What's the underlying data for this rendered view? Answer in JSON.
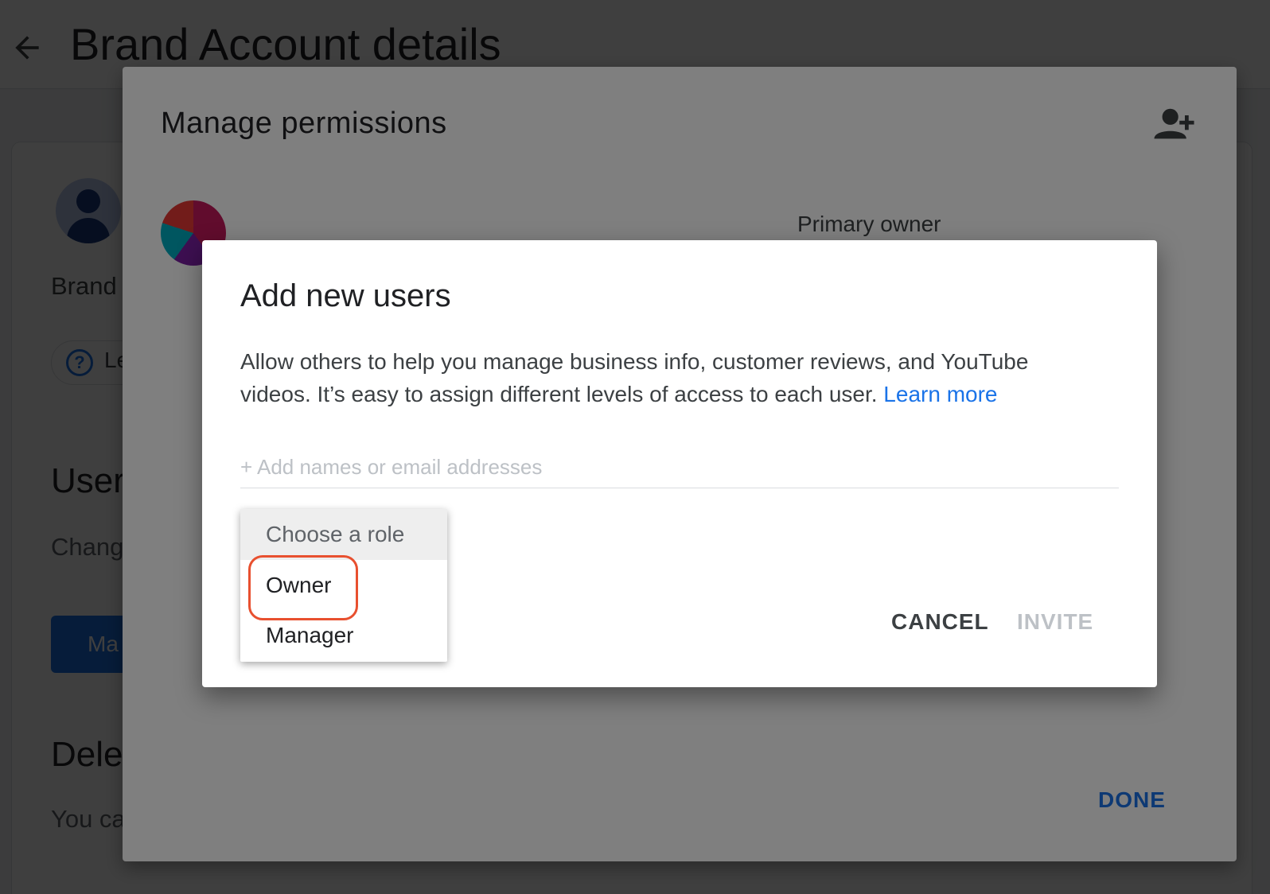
{
  "background": {
    "page_title": "Brand Account details",
    "brand_label": "Brand",
    "learn_chip_label": "Le",
    "users_heading": "User",
    "change_text": "Chang",
    "manage_button_label": "Ma",
    "delete_heading": "Dele",
    "you_can_text": "You ca"
  },
  "permissions_dialog": {
    "title": "Manage permissions",
    "add_user_icon": "person-add-icon",
    "owner_role": "Primary owner",
    "done_label": "DONE"
  },
  "add_users_dialog": {
    "title": "Add new users",
    "description": "Allow others to help you manage business info, customer reviews, and YouTube videos. It’s easy to assign different levels of access to each user.",
    "learn_more": "Learn more",
    "input_placeholder": "+ Add names or email addresses",
    "input_value": "",
    "cancel_label": "CANCEL",
    "invite_label": "INVITE"
  },
  "role_menu": {
    "header": "Choose a role",
    "options": [
      "Owner",
      "Manager"
    ],
    "highlighted": "Owner"
  },
  "colors": {
    "accent": "#1a73e8",
    "highlight_ring": "#e8502f",
    "disabled_text": "#bdc1c6"
  }
}
